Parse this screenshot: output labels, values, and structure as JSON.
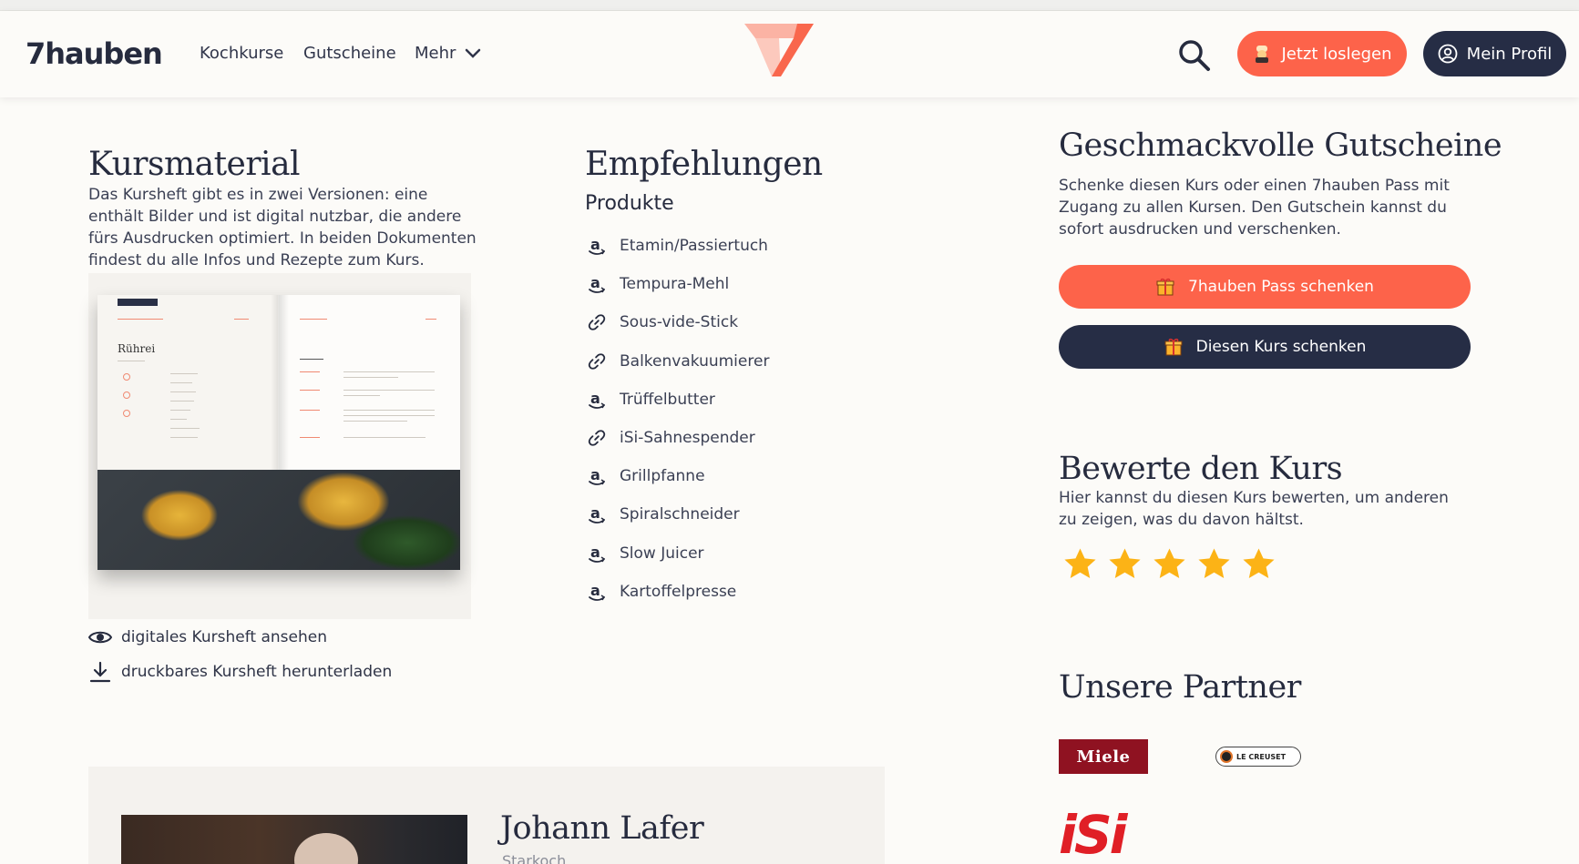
{
  "nav": {
    "brand": "7hauben",
    "links": [
      "Kochkurse",
      "Gutscheine"
    ],
    "more": "Mehr",
    "cta": "Jetzt loslegen",
    "profile": "Mein Profil"
  },
  "colors": {
    "accent": "#fd634a",
    "navy": "#262d45",
    "star": "#fcb316",
    "background": "#fcfbf8"
  },
  "kursmaterial": {
    "title": "Kursmaterial",
    "description": "Das Kursheft gibt es in zwei Versionen: eine enthält Bilder und ist digital nutzbar, die andere fürs Ausdrucken optimiert. In beiden Dokumenten findest du alle Infos und Rezepte zum Kurs.",
    "book_page_title": "Rührei",
    "view_link": "digitales Kursheft ansehen",
    "download_link": "druckbares Kursheft herunterladen"
  },
  "empfehlungen": {
    "title": "Empfehlungen",
    "subtitle": "Produkte",
    "products": [
      {
        "name": "Etamin/Passiertuch",
        "icon": "amazon-icon"
      },
      {
        "name": "Tempura-Mehl",
        "icon": "amazon-icon"
      },
      {
        "name": "Sous-vide-Stick",
        "icon": "link-icon"
      },
      {
        "name": "Balkenvakuumierer",
        "icon": "link-icon"
      },
      {
        "name": "Trüffelbutter",
        "icon": "amazon-icon"
      },
      {
        "name": "iSi-Sahnespender",
        "icon": "link-icon"
      },
      {
        "name": "Grillpfanne",
        "icon": "amazon-icon"
      },
      {
        "name": "Spiralschneider",
        "icon": "amazon-icon"
      },
      {
        "name": "Slow Juicer",
        "icon": "amazon-icon"
      },
      {
        "name": "Kartoffelpresse",
        "icon": "amazon-icon"
      }
    ]
  },
  "gutscheine": {
    "title": "Geschmackvolle Gutscheine",
    "description": "Schenke diesen Kurs oder einen 7hauben Pass mit Zugang zu allen Kursen. Den Gutschein kannst du sofort ausdrucken und verschenken.",
    "pass_button": "7hauben Pass schenken",
    "course_button": "Diesen Kurs schenken"
  },
  "bewertung": {
    "title": "Bewerte den Kurs",
    "description": "Hier kannst du diesen Kurs bewerten, um anderen zu zeigen, was du davon hältst.",
    "stars_total": 5
  },
  "partner": {
    "title": "Unsere Partner",
    "logos": [
      "Miele",
      "LE CREUSET",
      "iSi"
    ]
  },
  "chef": {
    "name": "Johann Lafer",
    "role": "Starkoch"
  }
}
